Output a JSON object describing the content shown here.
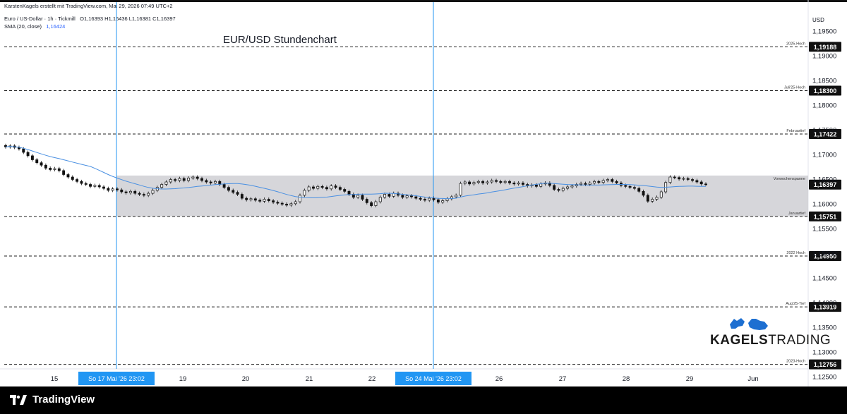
{
  "header": {
    "publisher_line": "KarstenKagels erstellt mit TradingView.com, Mai 29, 2026 07:49 UTC+2",
    "symbol_line": "Euro / US-Dollar · 1h · Tickmill",
    "ohlc": "O1,16393  H1,16436  L1,16381  C1,16397",
    "sma_label": "SMA (20, close)",
    "sma_value": "1,16424"
  },
  "footer": {
    "brand": "TradingView"
  },
  "watermark": {
    "brand_bold": "KAGELS",
    "brand_light": "TRADING"
  },
  "colors": {
    "sma": "#4a90e2",
    "marker": "#2196f3",
    "range_band": "#cfcfd4",
    "candle_up": "#ffffff",
    "candle_down": "#111111",
    "marker_label_bg": "#2196f3"
  },
  "chart_data": {
    "type": "candlestick",
    "title": "EUR/USD Stundenchart",
    "currency_label": "USD",
    "ylim": [
      1.1225,
      1.199
    ],
    "y_ticks": [
      "1,19500",
      "1,19000",
      "1,18500",
      "1,18000",
      "1,17500",
      "1,17000",
      "1,16500",
      "1,16000",
      "1,15500",
      "1,15000",
      "1,14500",
      "1,14000",
      "1,13500",
      "1,13000",
      "1,12500"
    ],
    "x_ticks": [
      "15",
      "19",
      "20",
      "21",
      "22",
      "26",
      "27",
      "28",
      "29",
      "Jun"
    ],
    "session_markers": [
      {
        "label": "So 17 Mai '26   23:02"
      },
      {
        "label": "So 24 Mai '26   23:02"
      }
    ],
    "range_band": {
      "low": 1.15751,
      "high": 1.1658,
      "label": "Vorwochenspanne"
    },
    "levels": [
      {
        "name": "2025-Hoch",
        "value": 1.19188,
        "label": "1,19188"
      },
      {
        "name": "Juli'25-Hoch",
        "value": 1.183,
        "label": "1,18300"
      },
      {
        "name": "Februartief",
        "value": 1.17422,
        "label": "1,17422"
      },
      {
        "name": "Januartief",
        "value": 1.15751,
        "label": "1,15751"
      },
      {
        "name": "2022 Hoch",
        "value": 1.1495,
        "label": "1,14950"
      },
      {
        "name": "Aug'25-Tief",
        "value": 1.13919,
        "label": "1,13919"
      },
      {
        "name": "2023-Hoch",
        "value": 1.12756,
        "label": "1,12756"
      }
    ],
    "last_price": {
      "value": 1.16397,
      "label": "1,16397"
    },
    "closes": [
      1.1716,
      1.1718,
      1.1715,
      1.1712,
      1.1705,
      1.1698,
      1.169,
      1.1684,
      1.1679,
      1.1673,
      1.167,
      1.1672,
      1.1668,
      1.166,
      1.1655,
      1.165,
      1.1646,
      1.1642,
      1.164,
      1.1636,
      1.1638,
      1.1635,
      1.1632,
      1.1628,
      1.1631,
      1.1629,
      1.1625,
      1.1623,
      1.1626,
      1.1622,
      1.162,
      1.1618,
      1.1622,
      1.1628,
      1.1634,
      1.164,
      1.1645,
      1.165,
      1.1648,
      1.1652,
      1.1648,
      1.1653,
      1.1655,
      1.1652,
      1.1648,
      1.1645,
      1.1643,
      1.1646,
      1.164,
      1.1634,
      1.1628,
      1.1624,
      1.162,
      1.1612,
      1.1609,
      1.1611,
      1.1608,
      1.1606,
      1.161,
      1.1607,
      1.1604,
      1.1602,
      1.16,
      1.1598,
      1.1601,
      1.1605,
      1.1618,
      1.1628,
      1.1635,
      1.1632,
      1.1636,
      1.1634,
      1.1631,
      1.1637,
      1.1634,
      1.163,
      1.1626,
      1.162,
      1.1614,
      1.1618,
      1.161,
      1.1603,
      1.1597,
      1.1605,
      1.1614,
      1.162,
      1.1616,
      1.1622,
      1.1618,
      1.1614,
      1.1617,
      1.1615,
      1.1612,
      1.161,
      1.1608,
      1.1612,
      1.1609,
      1.1604,
      1.1607,
      1.1611,
      1.1615,
      1.1618,
      1.1642,
      1.1645,
      1.1641,
      1.1644,
      1.1646,
      1.1643,
      1.1645,
      1.1648,
      1.1646,
      1.1644,
      1.1646,
      1.1643,
      1.1641,
      1.1643,
      1.164,
      1.1637,
      1.1639,
      1.1636,
      1.1641,
      1.1643,
      1.1638,
      1.163,
      1.1628,
      1.1632,
      1.1635,
      1.1637,
      1.164,
      1.1642,
      1.164,
      1.1643,
      1.1646,
      1.1644,
      1.1648,
      1.165,
      1.1646,
      1.1643,
      1.1638,
      1.1636,
      1.1634,
      1.1632,
      1.1626,
      1.1618,
      1.1606,
      1.161,
      1.1614,
      1.1625,
      1.1644,
      1.1655,
      1.1654,
      1.1651,
      1.1652,
      1.165,
      1.1648,
      1.1645,
      1.1641,
      1.164
    ]
  }
}
